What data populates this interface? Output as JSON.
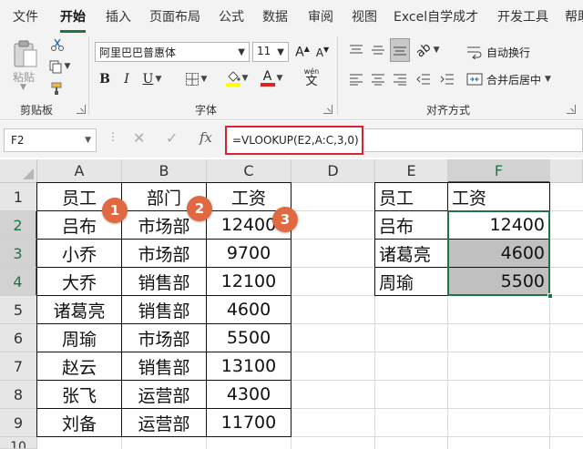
{
  "menu": {
    "tabs": [
      {
        "label": "文件",
        "active": false
      },
      {
        "label": "开始",
        "active": true
      },
      {
        "label": "插入",
        "active": false
      },
      {
        "label": "页面布局",
        "active": false
      },
      {
        "label": "公式",
        "active": false
      },
      {
        "label": "数据",
        "active": false
      },
      {
        "label": "审阅",
        "active": false
      },
      {
        "label": "视图",
        "active": false
      },
      {
        "label": "Excel自学成才",
        "active": false
      },
      {
        "label": "开发工具",
        "active": false
      },
      {
        "label": "帮助",
        "active": false
      }
    ]
  },
  "ribbon": {
    "clipboard": {
      "paste_label": "粘贴",
      "group_label": "剪贴板"
    },
    "font": {
      "font_name": "阿里巴巴普惠体",
      "font_size": "11",
      "group_label": "字体",
      "font_color": "#e02020",
      "fill_color": "#ffff00",
      "phonetic_label": "wén"
    },
    "alignment": {
      "wrap_label": "自动换行",
      "merge_label": "合并后居中",
      "group_label": "对齐方式"
    }
  },
  "formula_bar": {
    "name_box": "F2",
    "fx_label": "fx",
    "formula": "=VLOOKUP(E2,A:C,3,0)"
  },
  "grid": {
    "columns": [
      "A",
      "B",
      "C",
      "D",
      "E",
      "F"
    ],
    "rows": [
      "1",
      "2",
      "3",
      "4",
      "5",
      "6",
      "7",
      "8",
      "9"
    ],
    "partial_row": "10",
    "selected_column": "F",
    "selected_rows": [
      "2",
      "3",
      "4"
    ],
    "table_left": {
      "headers": [
        "员工",
        "部门",
        "工资"
      ],
      "rows": [
        [
          "吕布",
          "市场部",
          "12400"
        ],
        [
          "小乔",
          "市场部",
          "9700"
        ],
        [
          "大乔",
          "销售部",
          "12100"
        ],
        [
          "诸葛亮",
          "销售部",
          "4600"
        ],
        [
          "周瑜",
          "市场部",
          "5500"
        ],
        [
          "赵云",
          "销售部",
          "13100"
        ],
        [
          "张飞",
          "运营部",
          "4300"
        ],
        [
          "刘备",
          "运营部",
          "11700"
        ]
      ]
    },
    "table_right": {
      "headers": [
        "员工",
        "工资"
      ],
      "rows": [
        [
          "吕布",
          "12400"
        ],
        [
          "诸葛亮",
          "4600"
        ],
        [
          "周瑜",
          "5500"
        ]
      ]
    },
    "badges": [
      "1",
      "2",
      "3"
    ],
    "accent_color": "#217346",
    "badge_color": "#e06941"
  }
}
